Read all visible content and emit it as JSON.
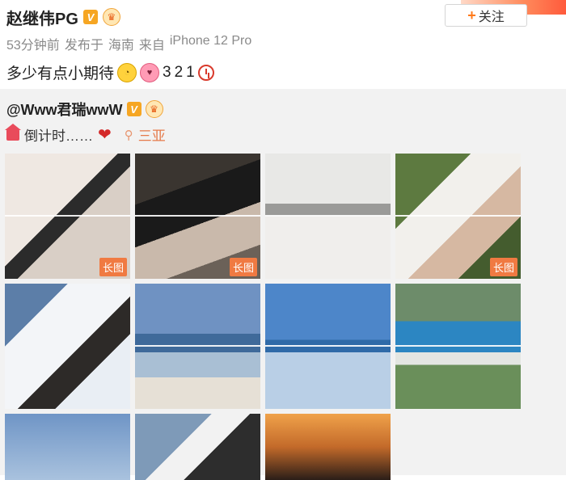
{
  "post": {
    "author": "赵继伟PG",
    "meta": [
      "53分钟前",
      "发布于",
      "海南",
      "来自",
      "iPhone 12 Pro"
    ],
    "text": "多少有点小期待",
    "countdown": [
      "3",
      "2",
      "1"
    ],
    "follow_label": "关注"
  },
  "repost": {
    "author": "@Www君瑞wwW",
    "text": "倒计时……",
    "location": "三亚"
  },
  "grid": {
    "long_image_label": "长图",
    "tiles": [
      {
        "long": false
      },
      {
        "long": false
      },
      {
        "long": false
      },
      {
        "long": false
      },
      {
        "long": true
      },
      {
        "long": false
      },
      {
        "long": true
      },
      {
        "long": true
      },
      {
        "long": false
      },
      {
        "long": false
      },
      {
        "long": false
      }
    ]
  },
  "colors": {
    "accent": "#ff7a1a",
    "location": "#e57a4a",
    "long_badge": "#f07a42",
    "repost_bg": "#f2f2f2"
  }
}
